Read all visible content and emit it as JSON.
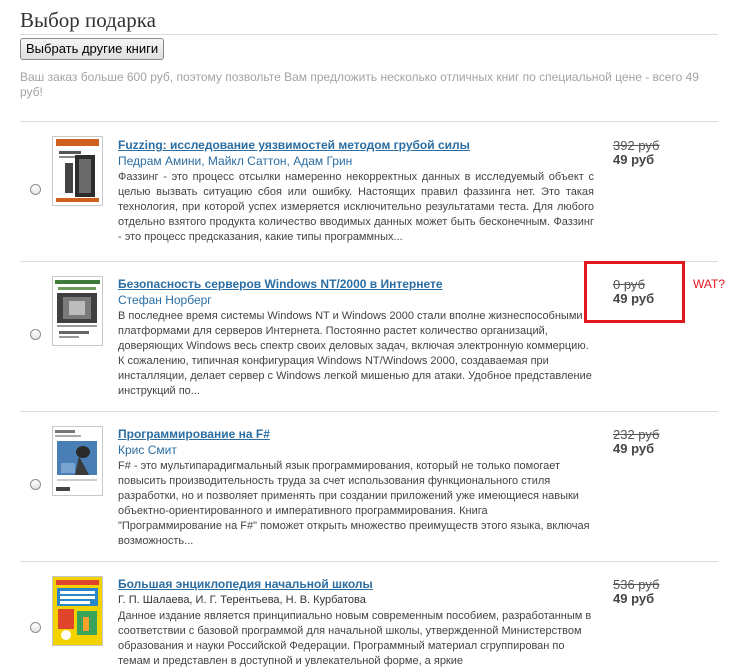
{
  "page": {
    "title": "Выбор подарка",
    "choose_button": "Выбрать другие книги",
    "intro": "Ваш заказ больше 600 руб, поэтому позвольте Вам предложить несколько отличных книг по специальной цене - всего 49 руб!"
  },
  "annotation": {
    "wat_label": "WAT?",
    "box_color": "#e3171e"
  },
  "books": [
    {
      "title": "Fuzzing: исследование уязвимостей методом грубой силы",
      "authors": "Педрам Амини, Майкл Саттон, Адам Грин",
      "description": "Фаззинг - это процесс отсылки намеренно некорректных данных в исследуемый объект с целью вызвать ситуацию сбоя или ошибку. Настоящих правил фаззинга нет. Это такая технология, при которой успех измеряется исключительно результатами теста. Для любого отдельно взятого продукта количество вводимых данных может быть бесконечным. Фаззинг - это процесс предсказания, какие типы программных...",
      "old_price": "392 руб",
      "new_price": "49 руб"
    },
    {
      "title": "Безопасность серверов Windows NT/2000 в Интернете",
      "authors": "Стефан Норберг",
      "description": "В последнее время системы Windows NT и Windows 2000 стали вполне жизнеспособными платформами для серверов Интернета. Постоянно растет количество организаций, доверяющих Windows весь спектр своих деловых задач, включая электронную коммерцию. К сожалению, типичная конфигурация Windows NT/Windows 2000, создаваемая при инсталляции, делает сервер с Windows легкой мишенью для атаки. Удобное представление инструкций по...",
      "old_price": "0 руб",
      "new_price": "49 руб"
    },
    {
      "title": "Программирование на F#",
      "authors": "Крис Смит",
      "description": "F# - это мультипарадигмальный язык программирования, который не только помогает повысить производительность труда за счет использования функционального стиля разработки, но и позволяет применять при создании приложений уже имеющиеся навыки объектно-ориентированного и императивного программирования. Книга \"Программирование на F#\" поможет открыть множество преимуществ этого языка, включая возможность...",
      "old_price": "232 руб",
      "new_price": "49 руб"
    },
    {
      "title": "Большая энциклопедия начальной школы",
      "authors": "Г. П. Шалаева, И. Г. Терентьева, Н. В. Курбатова",
      "description": "Данное издание является принципиально новым современным пособием, разработанным в соответствии с базовой программой для начальной школы, утвержденной Министерством образования и науки Российской Федерации. Программный материал сгруппирован по темам и представлен в доступной и увлекательной форме, а яркие",
      "old_price": "536 руб",
      "new_price": "49 руб"
    }
  ]
}
